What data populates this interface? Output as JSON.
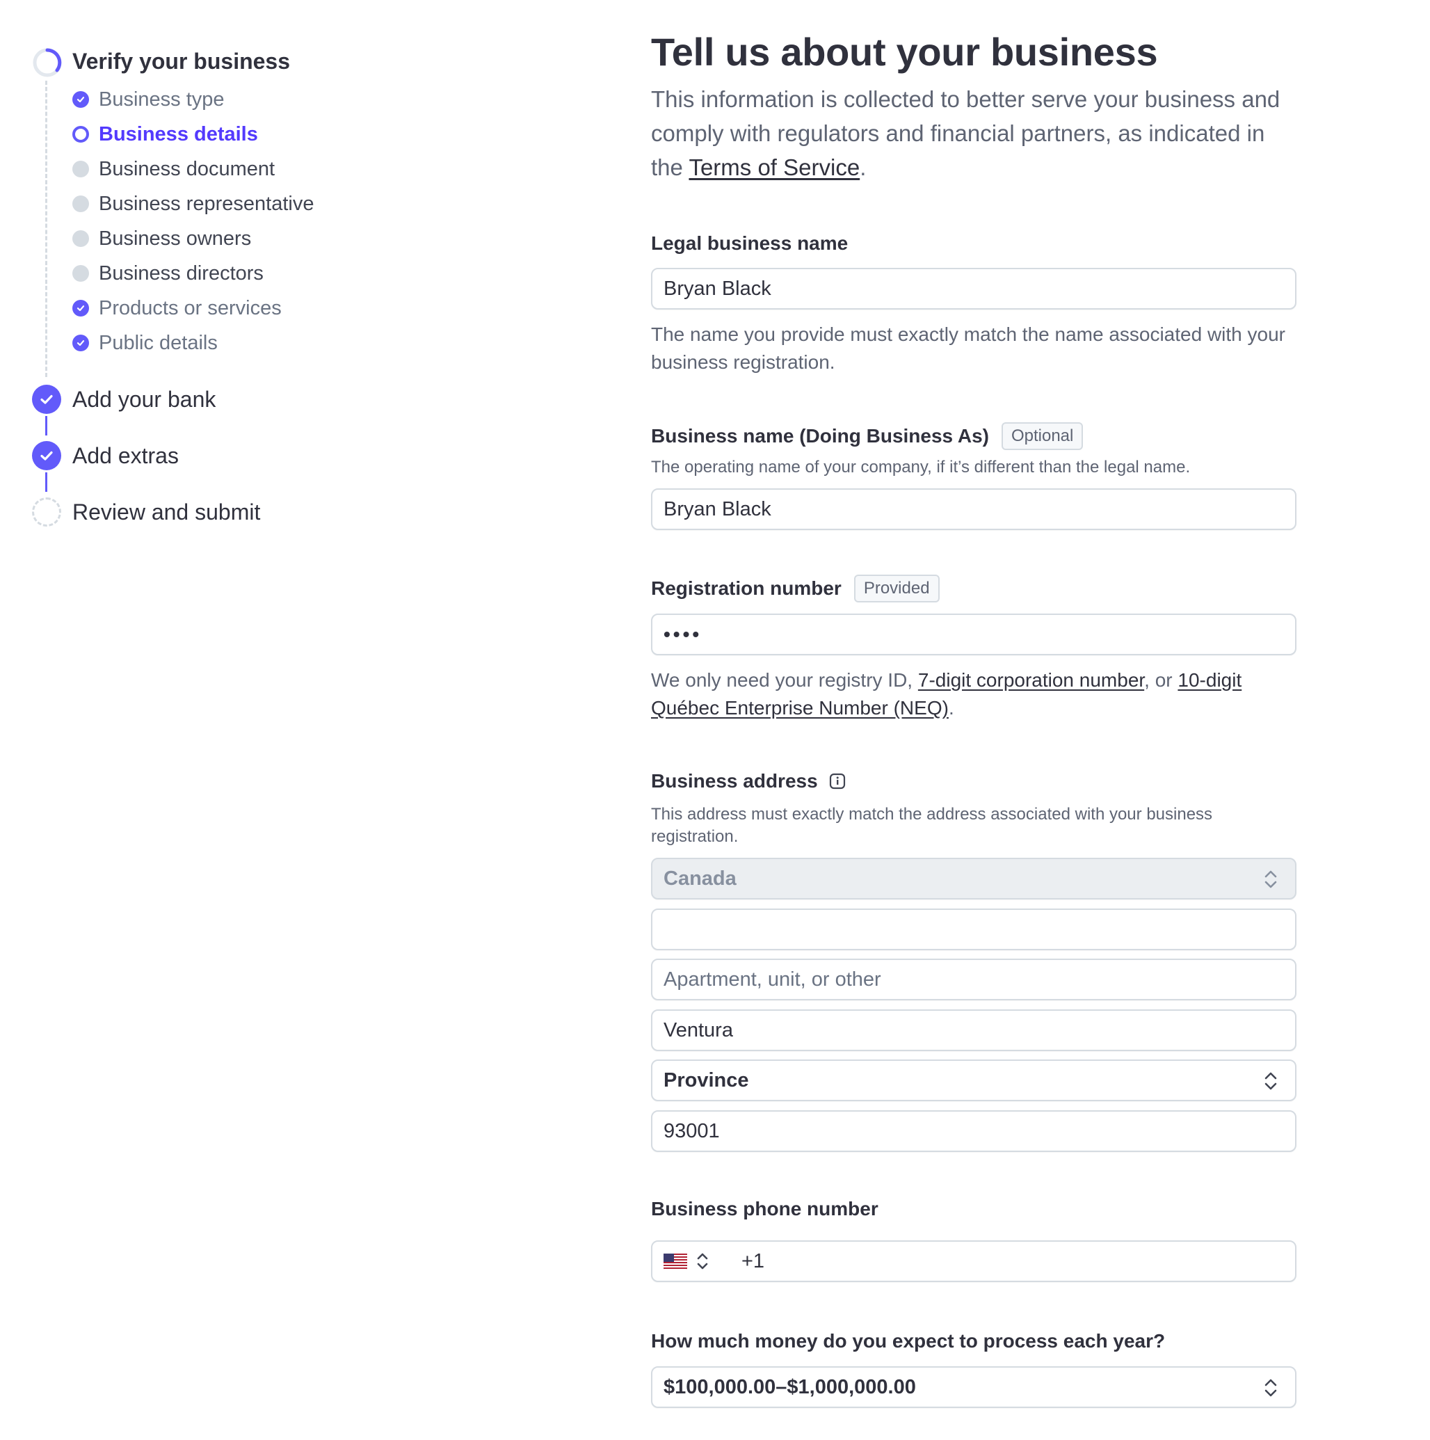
{
  "sidebar": {
    "steps": [
      {
        "title": "Verify your business",
        "status": "in-progress",
        "substeps": [
          {
            "label": "Business type",
            "status": "done"
          },
          {
            "label": "Business details",
            "status": "current"
          },
          {
            "label": "Business document",
            "status": "todo"
          },
          {
            "label": "Business representative",
            "status": "todo"
          },
          {
            "label": "Business owners",
            "status": "todo"
          },
          {
            "label": "Business directors",
            "status": "todo"
          },
          {
            "label": "Products or services",
            "status": "done"
          },
          {
            "label": "Public details",
            "status": "done"
          }
        ]
      },
      {
        "title": "Add your bank",
        "status": "done"
      },
      {
        "title": "Add extras",
        "status": "done"
      },
      {
        "title": "Review and submit",
        "status": "todo"
      }
    ]
  },
  "main": {
    "title": "Tell us about your business",
    "intro_before": "This information is collected to better serve your business and comply with regulators and financial partners, as indicated in the ",
    "intro_link": "Terms of Service",
    "intro_after": ".",
    "legal_name": {
      "label": "Legal business name",
      "value": "Bryan Black",
      "help": "The name you provide must exactly match the name associated with your business registration."
    },
    "dba": {
      "label": "Business name (Doing Business As)",
      "badge": "Optional",
      "help": "The operating name of your company, if it’s different than the legal name.",
      "value": "Bryan Black"
    },
    "registration": {
      "label": "Registration number",
      "badge": "Provided",
      "value": "••••",
      "help_before": "We only need your registry ID, ",
      "help_link1": "7-digit corporation number",
      "help_mid": ", or ",
      "help_link2": "10-digit Québec Enterprise Number (NEQ)",
      "help_after": "."
    },
    "address": {
      "label": "Business address",
      "help": "This address must exactly match the address associated with your business registration.",
      "country": "Canada",
      "line1": "",
      "line2_placeholder": "Apartment, unit, or other",
      "city": "Ventura",
      "province": "Province",
      "postal": "93001"
    },
    "phone": {
      "label": "Business phone number",
      "country_code": "+1",
      "value": ""
    },
    "volume": {
      "label": "How much money do you expect to process each year?",
      "value": "$100,000.00–$1,000,000.00"
    }
  },
  "colors": {
    "accent": "#625afa",
    "accent_text": "#533afd",
    "text": "#30313d",
    "muted": "#5e6473",
    "border": "#d5dbe1",
    "pending_dot": "#d5dbe1"
  },
  "icons": {
    "check": "check-icon",
    "progress": "progress-ring-icon",
    "info": "info-icon",
    "chevron": "chevron-up-down-icon",
    "flag": "us-flag-icon"
  }
}
